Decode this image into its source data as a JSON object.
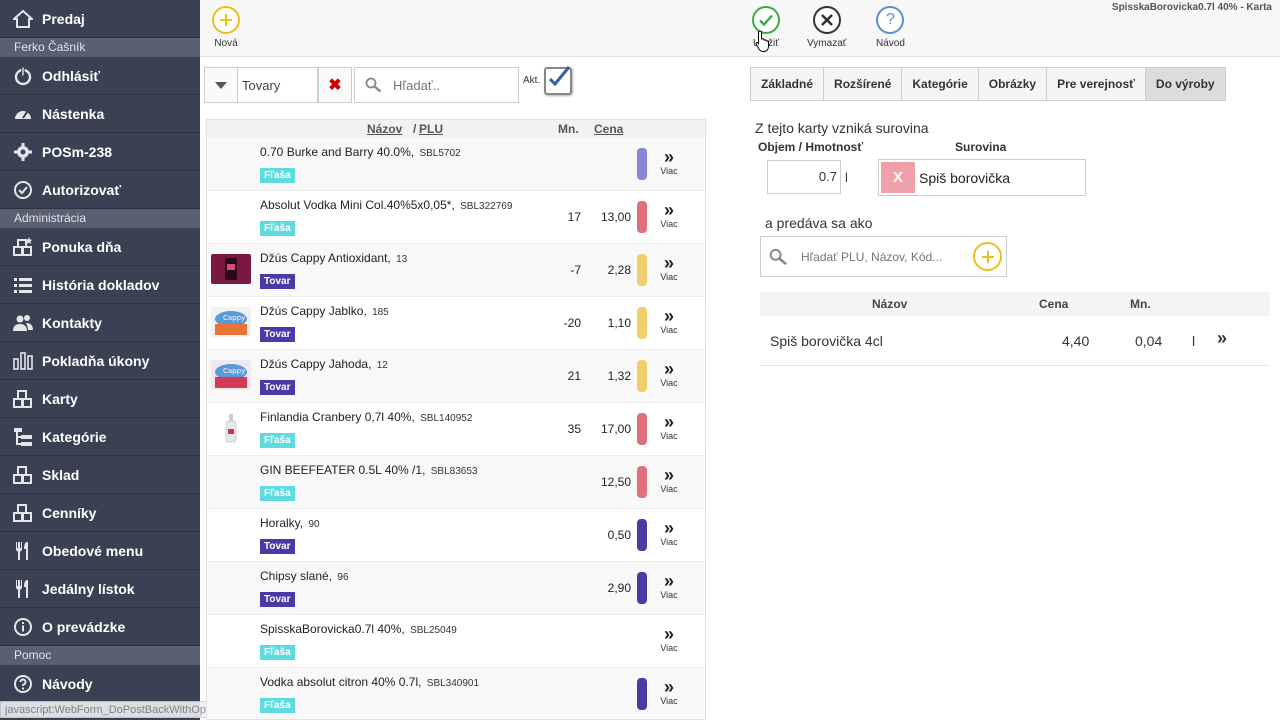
{
  "window_title": "SpisskaBorovicka0.7l 40% - Karta",
  "sidebar": {
    "items": [
      {
        "label": "Predaj",
        "icon": "home-icon"
      },
      {
        "section": "Ferko Čašník"
      },
      {
        "label": "Odhlásiť",
        "icon": "power-icon"
      },
      {
        "label": "Nástenka",
        "icon": "dashboard-icon"
      },
      {
        "label": "POSm-238",
        "icon": "gear-icon"
      },
      {
        "label": "Autorizovať",
        "icon": "check-circle-icon"
      },
      {
        "section": "Administrácia"
      },
      {
        "label": "Ponuka dňa",
        "icon": "boxes-star-icon"
      },
      {
        "label": "História dokladov",
        "icon": "list-icon"
      },
      {
        "label": "Kontakty",
        "icon": "users-icon"
      },
      {
        "label": "Pokladňa úkony",
        "icon": "bar-chart-icon"
      },
      {
        "label": "Karty",
        "icon": "boxes-icon"
      },
      {
        "label": "Kategórie",
        "icon": "tree-icon"
      },
      {
        "label": "Sklad",
        "icon": "boxes-icon"
      },
      {
        "label": "Cenníky",
        "icon": "boxes-icon"
      },
      {
        "label": "Obedové menu",
        "icon": "cutlery-icon"
      },
      {
        "label": "Jedálny lístok",
        "icon": "cutlery-icon"
      },
      {
        "label": "O prevádzke",
        "icon": "info-icon"
      },
      {
        "section": "Pomoc"
      },
      {
        "label": "Návody",
        "icon": "help-icon"
      }
    ]
  },
  "status_bar": "javascript:WebForm_DoPostBackWithOptions(new WebForm_PostBackOptions(...",
  "toolbar": {
    "new_label": "Nová",
    "save_label": "Uložiť",
    "clear_label": "Vymazať",
    "help_label": "Návod"
  },
  "filter": {
    "type_value": "Tovary",
    "search_placeholder": "Hľadať..",
    "akt_label": "Akt."
  },
  "list": {
    "headers": {
      "name": "Názov",
      "slash": "/",
      "plu": "PLU",
      "qty": "Mn.",
      "price": "Cena"
    },
    "more_label": "Viac",
    "rows": [
      {
        "name": "0.70 Burke and Barry 40.0%,",
        "plu": "SBL5702",
        "tag": "Fľaša",
        "qty": "",
        "price": "",
        "pill": "#8a86d6",
        "thumb": ""
      },
      {
        "name": "Absolut Vodka Mini Col.40%5x0,05*,",
        "plu": "SBL322769",
        "tag": "Fľaša",
        "qty": "17",
        "price": "13,00",
        "pill": "#e2707a",
        "thumb": ""
      },
      {
        "name": "Džús Cappy Antioxidant,",
        "plu": "13",
        "tag": "Tovar",
        "qty": "-7",
        "price": "2,28",
        "pill": "#f2cf6a",
        "thumb": "cappy-antioxidant"
      },
      {
        "name": "Džús Cappy Jablko,",
        "plu": "185",
        "tag": "Tovar",
        "qty": "-20",
        "price": "1,10",
        "pill": "#f2cf6a",
        "thumb": "cappy-jablko"
      },
      {
        "name": "Džús Cappy Jahoda,",
        "plu": "12",
        "tag": "Tovar",
        "qty": "21",
        "price": "1,32",
        "pill": "#f2cf6a",
        "thumb": "cappy-jahoda"
      },
      {
        "name": "Finlandia Cranbery 0,7l 40%,",
        "plu": "SBL140952",
        "tag": "Fľaša",
        "qty": "35",
        "price": "17,00",
        "pill": "#e2707a",
        "thumb": "finlandia-bottle"
      },
      {
        "name": "GIN BEEFEATER 0.5L 40% /1,",
        "plu": "SBL83653",
        "tag": "Fľaša",
        "qty": "",
        "price": "12,50",
        "pill": "#e2707a",
        "thumb": ""
      },
      {
        "name": "Horalky,",
        "plu": "90",
        "tag": "Tovar",
        "qty": "",
        "price": "0,50",
        "pill": "#4a3aa8",
        "thumb": ""
      },
      {
        "name": "Chipsy slané,",
        "plu": "96",
        "tag": "Tovar",
        "qty": "",
        "price": "2,90",
        "pill": "#4a3aa8",
        "thumb": ""
      },
      {
        "name": "SpisskaBorovicka0.7l 40%,",
        "plu": "SBL25049",
        "tag": "Fľaša",
        "qty": "",
        "price": "",
        "pill": "",
        "thumb": ""
      },
      {
        "name": "Vodka absolut citron 40% 0.7l,",
        "plu": "SBL340901",
        "tag": "Fľaša",
        "qty": "",
        "price": "",
        "pill": "#4a3aa8",
        "thumb": ""
      }
    ]
  },
  "tabs": [
    "Základné",
    "Rozšírené",
    "Kategórie",
    "Obrázky",
    "Pre verejnosť",
    "Do výroby"
  ],
  "active_tab": "Do výroby",
  "production": {
    "intro": "Z tejto karty vzniká surovina",
    "volume_header": "Objem / Hmotnosť",
    "ingredient_header": "Surovina",
    "volume_value": "0.7",
    "volume_unit": "l",
    "ingredient_remove": "X",
    "ingredient_name": "Spiš borovička",
    "sold_as_label": "a predáva sa ako",
    "search_placeholder": "Hľadať PLU, Názov, Kód...",
    "table_headers": {
      "name": "Názov",
      "price": "Cena",
      "qty": "Mn."
    },
    "rows": [
      {
        "name": "Spiš borovička 4cl",
        "price": "4,40",
        "qty": "0,04",
        "unit": "l"
      }
    ]
  },
  "colors": {
    "sidebar_bg": "#3a4152",
    "section_bg": "#5a6071",
    "tag_flasa": "#5fdbe0",
    "tag_tovar": "#4a3aa8",
    "new_icon": "#e8c21a",
    "save_icon": "#3daa4a",
    "clear_icon": "#333333",
    "help_icon": "#5a8fd0"
  }
}
